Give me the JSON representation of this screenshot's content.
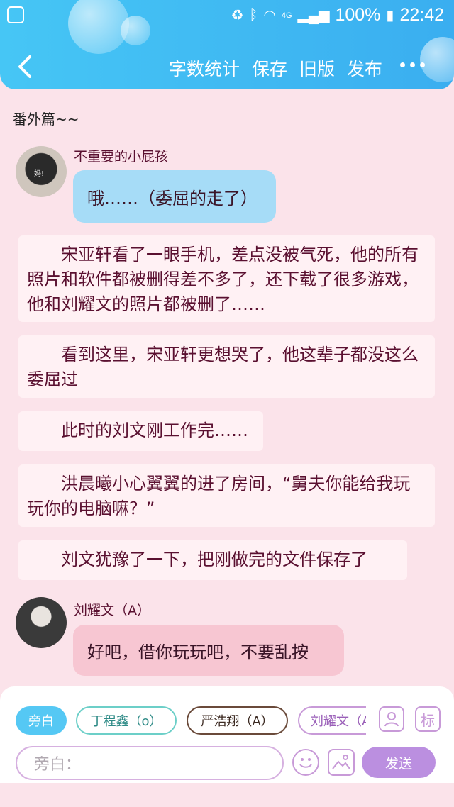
{
  "status_bar": {
    "battery": "100%",
    "time": "22:42",
    "network": "4G"
  },
  "toolbar": {
    "back_icon": "back-arrow-icon",
    "word_count": "字数统计",
    "save": "保存",
    "old_version": "旧版",
    "publish": "发布",
    "more_icon": "more-icon"
  },
  "chapter_title": "番外篇~~",
  "messages": {
    "first_speaker": {
      "name": "不重要的小屁孩",
      "avatar_text": "妈!",
      "text": "哦……（委屈的走了）"
    },
    "narration": [
      "宋亚轩看了一眼手机，差点没被气死，他的所有照片和软件都被删得差不多了，还下载了很多游戏，他和刘耀文的照片都被删了……",
      "看到这里，宋亚轩更想哭了，他这辈子都没这么委屈过",
      "此时的刘文刚工作完……",
      "洪晨曦小心翼翼的进了房间，“舅夫你能给我玩玩你的电脑嘛？”",
      "刘文犹豫了一下，把刚做完的文件保存了"
    ],
    "second_speaker": {
      "name": "刘耀文（A）",
      "text": "好吧，借你玩玩吧，不要乱按"
    }
  },
  "composer": {
    "roles": [
      "旁白",
      "丁程鑫（o）",
      "严浩翔（A）",
      "刘耀文（A）"
    ],
    "role_icon": "user-card-icon",
    "tag_label": "标",
    "input_placeholder": "旁白：",
    "emoji_icon": "emoji-icon",
    "image_icon": "image-icon",
    "send": "发送"
  },
  "colors": {
    "header": "#3fb8f2",
    "background": "#fbe3ea",
    "blue_bubble": "#a6dcf7",
    "pink_bubble": "#f7c6d2",
    "send_button": "#bb8fe0"
  }
}
